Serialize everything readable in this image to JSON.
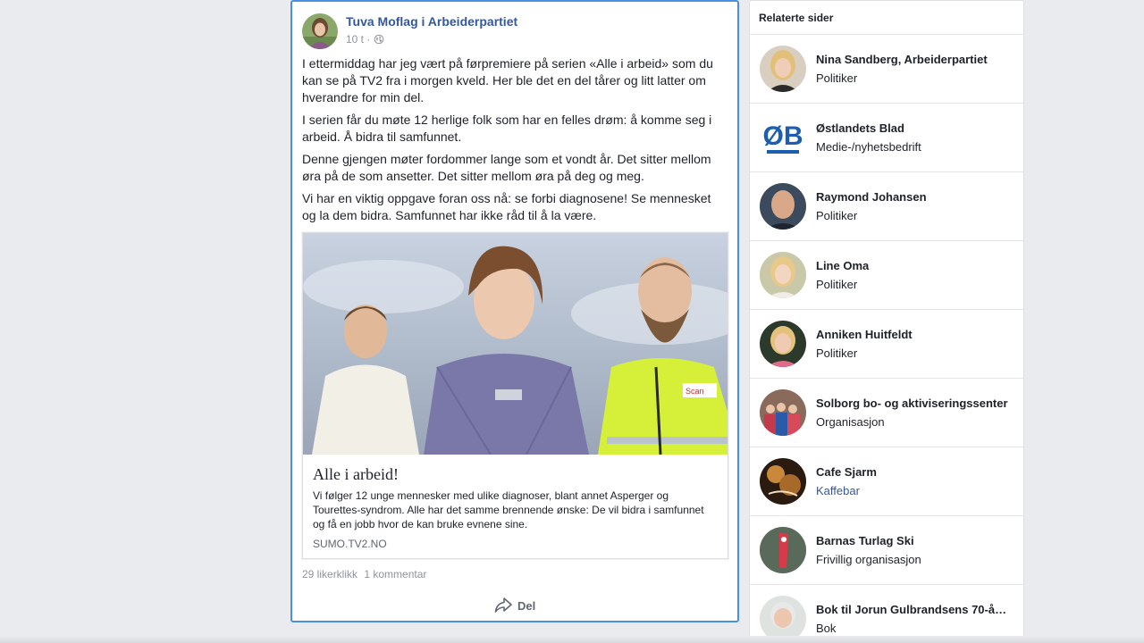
{
  "post": {
    "author": "Tuva Moflag i Arbeiderpartiet",
    "time": "10 t ·",
    "paragraphs": [
      "I ettermiddag har jeg vært på førpremiere på serien «Alle i arbeid» som du kan se på TV2 fra i morgen kveld. Her ble det en del tårer og litt latter om hverandre for min del.",
      "I serien får du møte 12 herlige folk som har en felles drøm: å komme seg i arbeid. Å bidra til samfunnet.",
      "Denne gjengen møter fordommer lange som et vondt år. Det sitter mellom øra på de som ansetter. Det sitter mellom øra på deg og meg.",
      "Vi har en viktig oppgave foran oss nå: se forbi diagnosene! Se mennesket og la dem bidra. Samfunnet har ikke råd til å la være."
    ],
    "link": {
      "title": "Alle i arbeid!",
      "description": "Vi følger 12 unge mennesker med ulike diagnoser, blant annet Asperger og Tourettes-syndrom. Alle har det samme brennende ønske: De vil bidra i samfunnet og få en jobb hvor de kan bruke evnene sine.",
      "domain": "SUMO.TV2.NO"
    },
    "likes": "29 likerklikk",
    "comments": "1 kommentar",
    "share_label": "Del",
    "icons": {
      "privacy": "globe-icon",
      "share": "share-arrow-icon"
    }
  },
  "sidebar": {
    "title": "Relaterte sider",
    "items": [
      {
        "name": "Nina Sandberg, Arbeiderpartiet",
        "category": "Politiker"
      },
      {
        "name": "Østlandets Blad",
        "category": "Medie-/nyhetsbedrift"
      },
      {
        "name": "Raymond Johansen",
        "category": "Politiker"
      },
      {
        "name": "Line Oma",
        "category": "Politiker"
      },
      {
        "name": "Anniken Huitfeldt",
        "category": "Politiker"
      },
      {
        "name": "Solborg bo- og aktiviseringssenter",
        "category": "Organisasjon"
      },
      {
        "name": "Cafe Sjarm",
        "category": "Kaffebar"
      },
      {
        "name": "Barnas Turlag Ski",
        "category": "Frivillig organisasjon"
      },
      {
        "name": "Bok til Jorun Gulbrandsens 70-å…",
        "category": "Bok"
      }
    ]
  },
  "colors": {
    "link_blue": "#365899",
    "focus_border": "#4a90e2",
    "background": "#e9ebee"
  }
}
